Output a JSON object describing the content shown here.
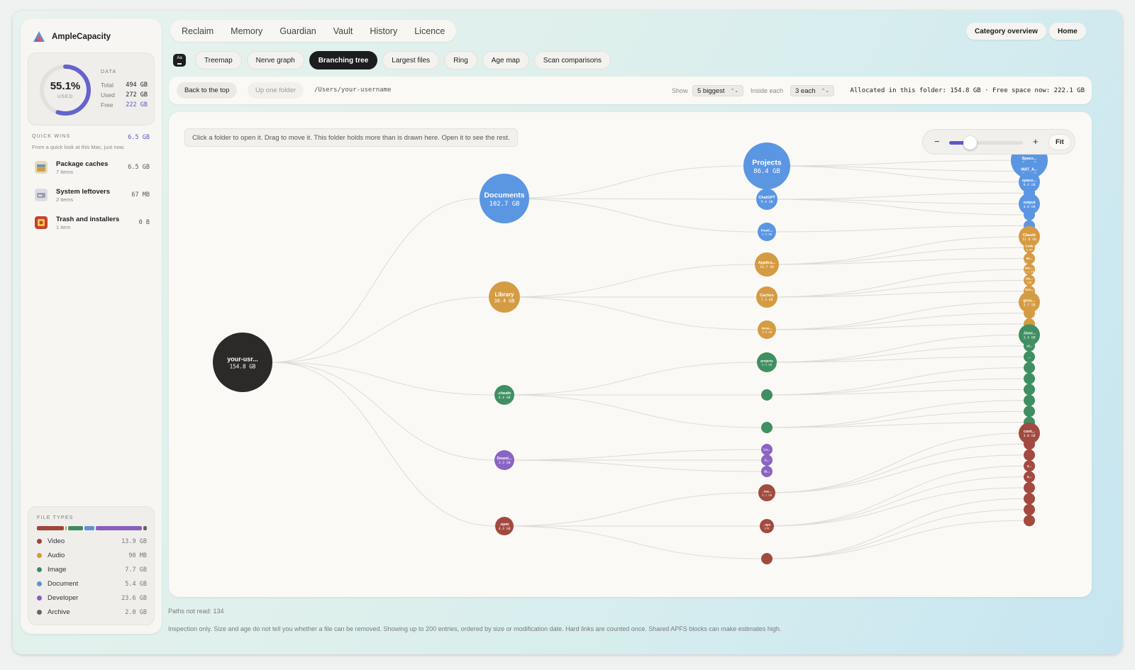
{
  "app": {
    "name": "AmpleCapacity"
  },
  "usage": {
    "percent": "55.1%",
    "percent_value": 55.1,
    "used_caption": "USED",
    "data_label": "DATA",
    "rows": [
      {
        "key": "Total",
        "value": "494 GB"
      },
      {
        "key": "Used",
        "value": "272 GB"
      },
      {
        "key": "Free",
        "value": "222 GB"
      }
    ]
  },
  "quick_wins": {
    "title": "QUICK WINS",
    "total": "6.5 GB",
    "subtitle": "From a quick look at this Mac, just now.",
    "items": [
      {
        "title": "Package caches",
        "count": "7 items",
        "size": "6.5 GB",
        "icon": "package-icon"
      },
      {
        "title": "System leftovers",
        "count": "2 items",
        "size": "67 MB",
        "icon": "drive-icon"
      },
      {
        "title": "Trash and installers",
        "count": "1 item",
        "size": "0 B",
        "icon": "installer-icon"
      }
    ]
  },
  "file_types": {
    "title": "FILE TYPES",
    "items": [
      {
        "name": "Video",
        "size": "13.9 GB",
        "gb": 13.9,
        "color": "#a0443a"
      },
      {
        "name": "Audio",
        "size": "90 MB",
        "gb": 0.09,
        "color": "#d39a3f"
      },
      {
        "name": "Image",
        "size": "7.7 GB",
        "gb": 7.7,
        "color": "#3f8a63"
      },
      {
        "name": "Document",
        "size": "5.4 GB",
        "gb": 5.4,
        "color": "#5a93d8"
      },
      {
        "name": "Developer",
        "size": "23.6 GB",
        "gb": 23.6,
        "color": "#8a5ebd"
      },
      {
        "name": "Archive",
        "size": "2.0 GB",
        "gb": 2.0,
        "color": "#666666"
      }
    ]
  },
  "nav": {
    "items": [
      "Reclaim",
      "Memory",
      "Guardian",
      "Vault",
      "History",
      "Licence"
    ]
  },
  "top_buttons": {
    "category": "Category overview",
    "home": "Home"
  },
  "subtabs": [
    "Treemap",
    "Nerve graph",
    "Branching tree",
    "Largest files",
    "Ring",
    "Age map",
    "Scan comparisons"
  ],
  "subtab_active": "Branching tree",
  "pathbar": {
    "back": "Back to the top",
    "up": "Up one folder",
    "path": "/Users/your-username",
    "show_label": "Show",
    "show_value": "5 biggest",
    "each_label": "Inside each",
    "each_value": "3 each",
    "info": "Allocated in this folder: 154.8 GB · Free space now: 222.1 GB"
  },
  "canvas": {
    "hint": "Click a folder to open it. Drag to move it. This folder holds more than is drawn here. Open it to see the rest.",
    "zoom": {
      "minus": "−",
      "plus": "+",
      "fit": "Fit",
      "level": 0.28
    }
  },
  "tree": {
    "colors": {
      "root": "#2b2a28",
      "blue": "#5b96e3",
      "orange": "#d59b43",
      "green": "#3f8f63",
      "purple": "#8a64c2",
      "red": "#a24a40",
      "link": "#dcdbd6"
    },
    "root": {
      "label": "your-usr...",
      "size": "154.8 GB"
    },
    "level1": [
      {
        "label": "Documents",
        "size": "102.7 GB",
        "color": "blue"
      },
      {
        "label": "Library",
        "size": "30.4 GB",
        "color": "orange"
      },
      {
        "label": ".claude",
        "size": "4.4 GB",
        "color": "green"
      },
      {
        "label": "Downl...",
        "size": "3.3 GB",
        "color": "purple"
      },
      {
        "label": ".npm",
        "size": "4.3 GB",
        "color": "red"
      }
    ],
    "level2": [
      {
        "label": "Projects",
        "size": "86.4 GB",
        "color": "blue",
        "parent": 0
      },
      {
        "label": "ChatGPT",
        "size": "9.4 GB",
        "color": "blue",
        "parent": 0
      },
      {
        "label": "PostC...",
        "size": "3.9 GB",
        "color": "blue",
        "parent": 0
      },
      {
        "label": "Applica...",
        "size": "14.7 GB",
        "color": "orange",
        "parent": 1
      },
      {
        "label": "Caches",
        "size": "7.3 GB",
        "color": "orange",
        "parent": 1
      },
      {
        "label": "Grou...",
        "size": "3.8 GB",
        "color": "orange",
        "parent": 1
      },
      {
        "label": "projects",
        "size": "3.5 GB",
        "color": "green",
        "parent": 2
      },
      {
        "label": "",
        "size": "",
        "color": "green",
        "parent": 2
      },
      {
        "label": "",
        "size": "",
        "color": "green",
        "parent": 2
      },
      {
        "label": "Lo...",
        "size": "",
        "color": "purple",
        "parent": 3
      },
      {
        "label": "C...",
        "size": "",
        "color": "purple",
        "parent": 3
      },
      {
        "label": "Si...",
        "size": "",
        "color": "purple",
        "parent": 3
      },
      {
        "label": "_cac...",
        "size": "3.1 GB",
        "color": "red",
        "parent": 4
      },
      {
        "label": "_npx",
        "size": "276",
        "color": "red",
        "parent": 4
      },
      {
        "label": "",
        "size": "",
        "color": "red",
        "parent": 4
      }
    ],
    "level3": [
      {
        "label": "Space...",
        "size": "51.7 GB",
        "color": "blue",
        "parent": 0,
        "weight": 3
      },
      {
        "label": "MAT_A...",
        "size": "15.6 GB",
        "color": "blue",
        "parent": 0,
        "weight": 2
      },
      {
        "label": "space...",
        "size": "9.4 GB",
        "color": "blue",
        "parent": 0,
        "weight": 2
      },
      {
        "label": "",
        "size": "",
        "color": "blue",
        "parent": 1,
        "weight": 1
      },
      {
        "label": "output",
        "size": "4.0 GB",
        "color": "blue",
        "parent": 1,
        "weight": 2
      },
      {
        "label": "",
        "size": "",
        "color": "blue",
        "parent": 1,
        "weight": 1
      },
      {
        "label": "",
        "size": "",
        "color": "blue",
        "parent": 2,
        "weight": 1
      },
      {
        "label": "Claude",
        "size": "12.8 GB",
        "color": "orange",
        "parent": 3,
        "weight": 2
      },
      {
        "label": "Code",
        "size": "6.0G",
        "color": "orange",
        "parent": 3,
        "weight": 1
      },
      {
        "label": "Br...",
        "size": "",
        "color": "orange",
        "parent": 3,
        "weight": 1
      },
      {
        "label": "mo-...",
        "size": "2.1 GB",
        "color": "orange",
        "parent": 4,
        "weight": 1
      },
      {
        "label": "Ho...",
        "size": "19G",
        "color": "orange",
        "parent": 4,
        "weight": 1
      },
      {
        "label": "Gro...",
        "size": "12G",
        "color": "orange",
        "parent": 4,
        "weight": 1
      },
      {
        "label": "grou...",
        "size": "3.7 GB",
        "color": "orange",
        "parent": 5,
        "weight": 2
      },
      {
        "label": "",
        "size": "",
        "color": "orange",
        "parent": 5,
        "weight": 1
      },
      {
        "label": "",
        "size": "",
        "color": "orange",
        "parent": 5,
        "weight": 1
      },
      {
        "label": ".User...",
        "size": "3.4 GB",
        "color": "green",
        "parent": 6,
        "weight": 2
      },
      {
        "label": ".cl...",
        "size": "",
        "color": "green",
        "parent": 6,
        "weight": 1
      },
      {
        "label": "...",
        "size": "",
        "color": "green",
        "parent": 6,
        "weight": 1
      },
      {
        "label": "",
        "size": "",
        "color": "green",
        "parent": 7,
        "weight": 1
      },
      {
        "label": "",
        "size": "",
        "color": "green",
        "parent": 7,
        "weight": 1
      },
      {
        "label": "",
        "size": "",
        "color": "green",
        "parent": 7,
        "weight": 1
      },
      {
        "label": "",
        "size": "",
        "color": "green",
        "parent": 8,
        "weight": 1
      },
      {
        "label": "",
        "size": "",
        "color": "green",
        "parent": 8,
        "weight": 1
      },
      {
        "label": "",
        "size": "",
        "color": "green",
        "parent": 8,
        "weight": 1
      },
      {
        "label": "cont...",
        "size": "3.0 GB",
        "color": "red",
        "parent": 12,
        "weight": 2
      },
      {
        "label": "",
        "size": "",
        "color": "red",
        "parent": 12,
        "weight": 1
      },
      {
        "label": "",
        "size": "",
        "color": "red",
        "parent": 12,
        "weight": 1
      },
      {
        "label": "2...",
        "size": "",
        "color": "red",
        "parent": 13,
        "weight": 1
      },
      {
        "label": "5...",
        "size": "",
        "color": "red",
        "parent": 13,
        "weight": 1
      },
      {
        "label": "",
        "size": "",
        "color": "red",
        "parent": 13,
        "weight": 1
      },
      {
        "label": "",
        "size": "",
        "color": "red",
        "parent": 14,
        "weight": 1
      },
      {
        "label": "",
        "size": "",
        "color": "red",
        "parent": 14,
        "weight": 1
      },
      {
        "label": "",
        "size": "",
        "color": "red",
        "parent": 14,
        "weight": 1
      }
    ]
  },
  "footer": {
    "unread": "Paths not read: 134",
    "note": "Inspection only. Size and age do not tell you whether a file can be removed. Showing up to 200 entries, ordered by size or modification date. Hard links are counted once. Shared APFS blocks can make estimates high."
  }
}
